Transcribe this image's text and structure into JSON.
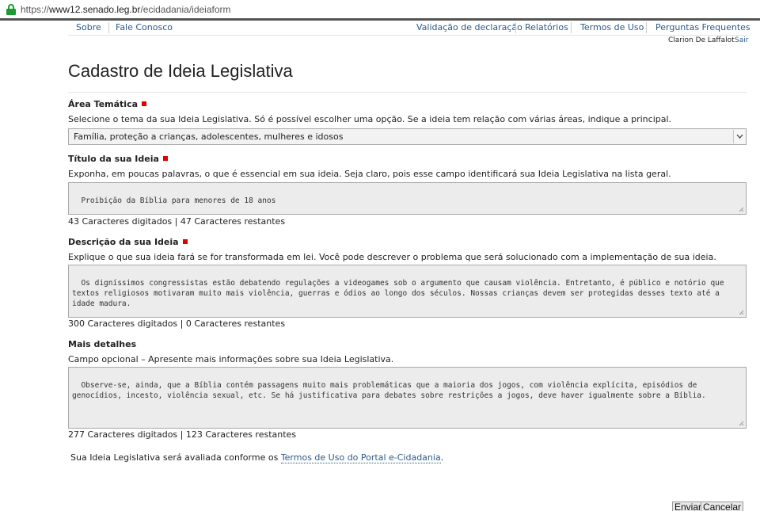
{
  "browser": {
    "url_scheme": "https://",
    "url_host": "www12.senado.leg.br",
    "url_path": "/ecidadania/ideiaform"
  },
  "nav": {
    "left": [
      "Sobre",
      "Fale Conosco"
    ],
    "right": [
      "Validação de declaração",
      "Relatórios",
      "Termos de Uso",
      "Perguntas Frequentes"
    ]
  },
  "user": {
    "name": "Clarion De Laffalot",
    "logout": "Sair"
  },
  "page": {
    "title": "Cadastro de Ideia Legislativa"
  },
  "form": {
    "area": {
      "label": "Área Temática",
      "help": "Selecione o tema da sua Ideia Legislativa. Só é possível escolher uma opção. Se a ideia tem relação com várias áreas, indique a principal.",
      "selected": "Família, proteção a crianças, adolescentes, mulheres e idosos"
    },
    "title": {
      "label": "Título da sua Ideia",
      "help": "Exponha, em poucas palavras, o que é essencial em sua ideia. Seja claro, pois esse campo identificará sua Ideia Legislativa na lista geral.",
      "value": "Proibição da Bíblia para menores de 18 anos",
      "counter": "43 Caracteres digitados | 47 Caracteres restantes"
    },
    "description": {
      "label": "Descrição da sua Ideia",
      "help": "Explique o que sua ideia fará se for transformada em lei. Você pode descrever o problema que será solucionado com a implementação de sua ideia.",
      "value": "Os digníssimos congressistas estão debatendo regulações a videogames sob o argumento que causam violência. Entretanto, é público e notório que textos religiosos motivaram muito mais violência, guerras e ódios ao longo dos séculos. Nossas crianças devem ser protegidas desses texto até a idade madura.",
      "counter": "300 Caracteres digitados | 0 Caracteres restantes"
    },
    "details": {
      "label": "Mais detalhes",
      "help": "Campo opcional – Apresente mais informações sobre sua Ideia Legislativa.",
      "value": "Observe-se, ainda, que a Bíblia contém passagens muito mais problemáticas que a maioria dos jogos, com violência explícita, episódios de genocídios, incesto, violência sexual, etc. Se há justificativa para debates sobre restrições a jogos, deve haver igualmente sobre a Bíblia.",
      "counter": "277 Caracteres digitados | 123 Caracteres restantes"
    },
    "notice_text": "Sua Ideia Legislativa será avaliada conforme os ",
    "notice_link": "Termos de Uso do Portal e-Cidadania",
    "notice_end": ".",
    "submit": "Enviar",
    "cancel": "Cancelar"
  },
  "colors": {
    "link": "#2b5a8a",
    "required": "#e00000",
    "lock": "#1a9c30"
  }
}
